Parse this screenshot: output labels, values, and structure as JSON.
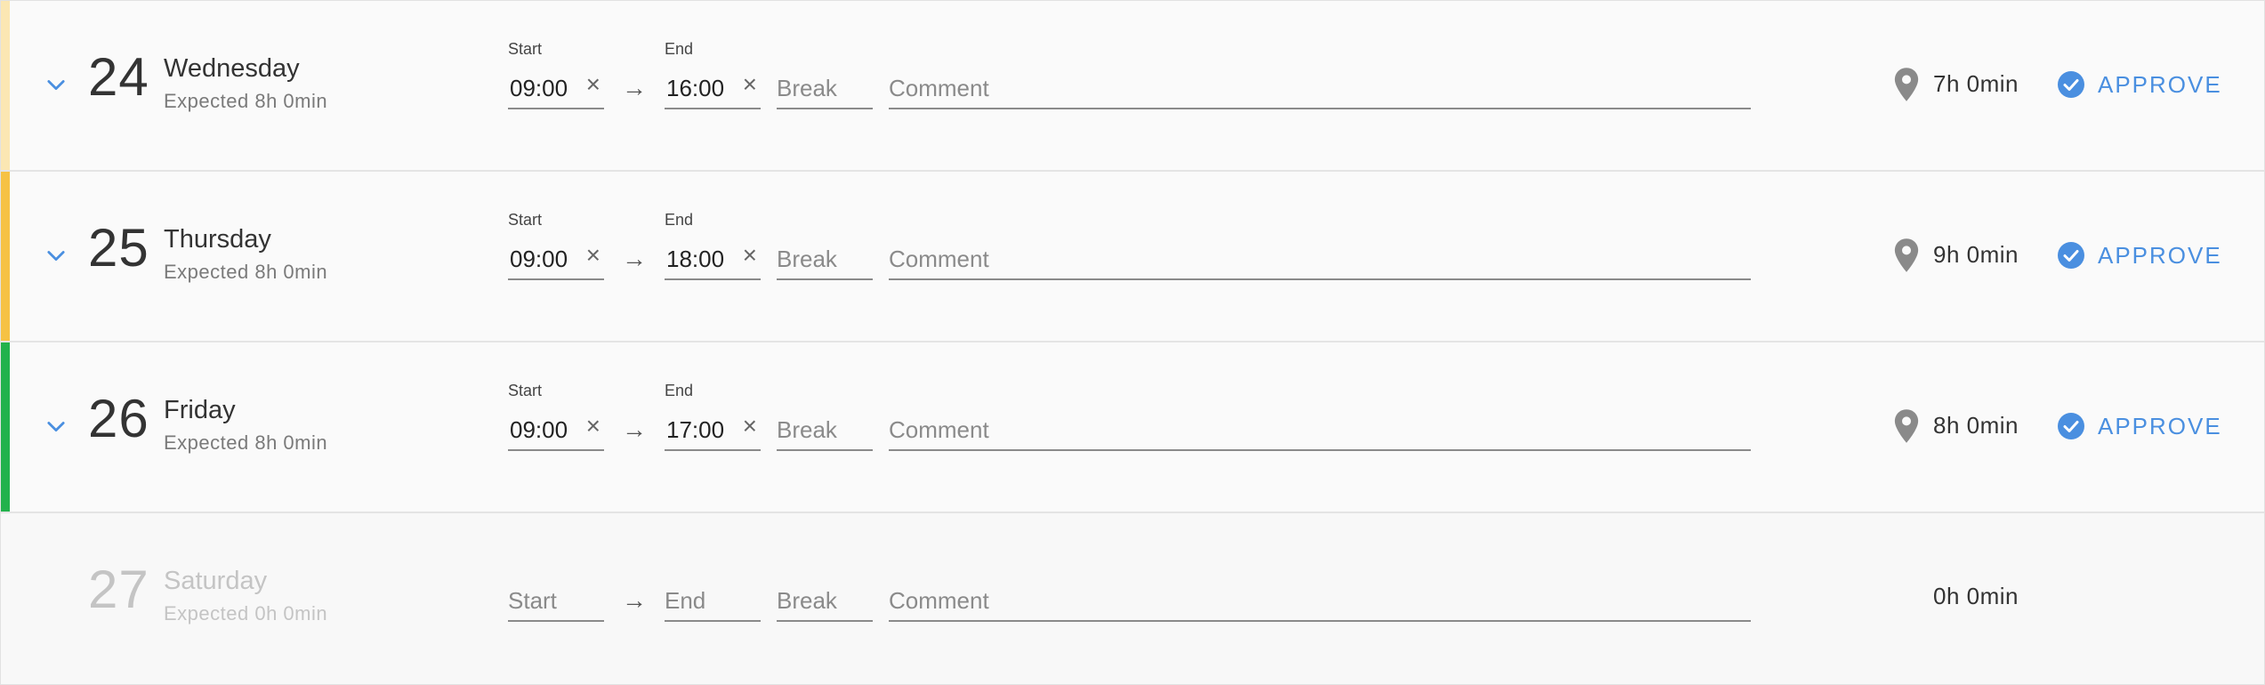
{
  "colors": {
    "accent": "#4a8fe0",
    "stripe_pending_light": "#fbe7b3",
    "stripe_pending": "#f6c244",
    "stripe_ok": "#22b24c"
  },
  "labels": {
    "start": "Start",
    "end": "End",
    "break_placeholder": "Break",
    "comment_placeholder": "Comment",
    "arrow": "→",
    "clear": "×",
    "approve": "APPROVE"
  },
  "days": [
    {
      "num": "24",
      "name": "Wednesday",
      "expected": "Expected 8h 0min",
      "start": "09:00",
      "end": "16:00",
      "duration": "7h 0min",
      "stripe": "#fbe7b3"
    },
    {
      "num": "25",
      "name": "Thursday",
      "expected": "Expected 8h 0min",
      "start": "09:00",
      "end": "18:00",
      "duration": "9h 0min",
      "stripe": "#f6c244"
    },
    {
      "num": "26",
      "name": "Friday",
      "expected": "Expected 8h 0min",
      "start": "09:00",
      "end": "17:00",
      "duration": "8h 0min",
      "stripe": "#22b24c"
    },
    {
      "num": "27",
      "name": "Saturday",
      "expected": "Expected 0h 0min",
      "start_placeholder": "Start",
      "end_placeholder": "End",
      "duration": "0h 0min"
    }
  ]
}
